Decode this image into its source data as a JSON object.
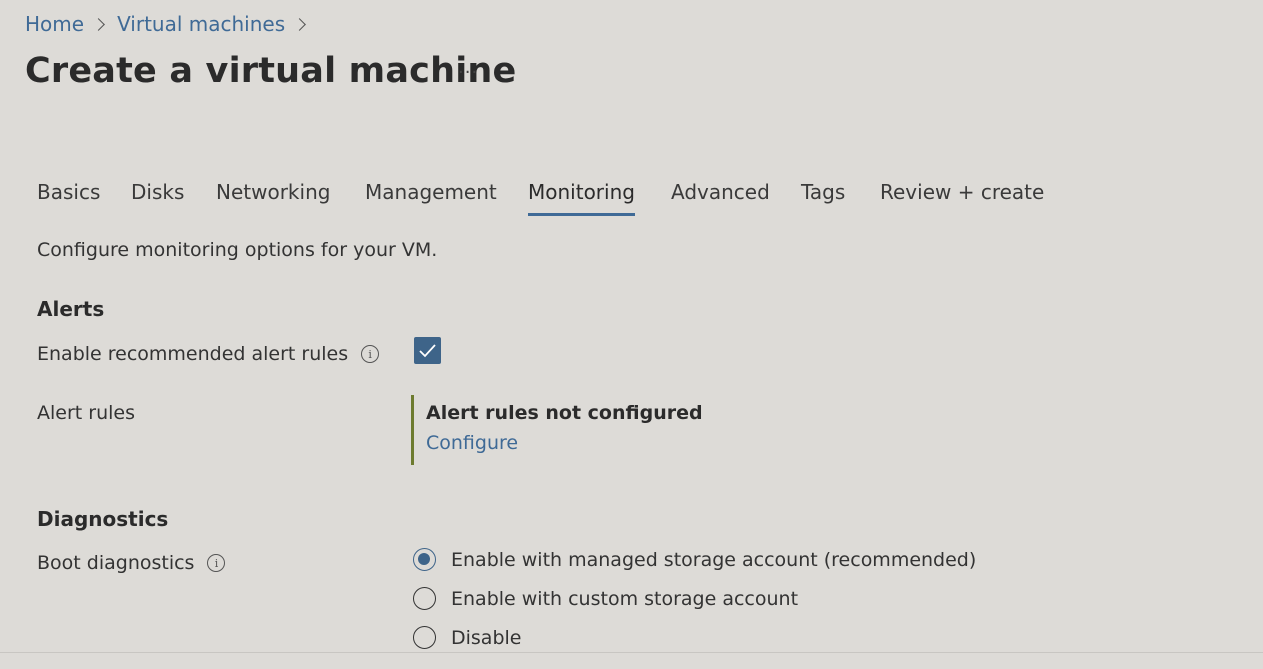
{
  "breadcrumb": {
    "items": [
      "Home",
      "Virtual machines"
    ]
  },
  "page": {
    "title": "Create a virtual machine",
    "more": "···"
  },
  "tabs": [
    {
      "label": "Basics"
    },
    {
      "label": "Disks"
    },
    {
      "label": "Networking"
    },
    {
      "label": "Management"
    },
    {
      "label": "Monitoring",
      "active": true
    },
    {
      "label": "Advanced"
    },
    {
      "label": "Tags"
    },
    {
      "label": "Review + create"
    }
  ],
  "description": "Configure monitoring options for your VM.",
  "alerts": {
    "heading": "Alerts",
    "enable_label": "Enable recommended alert rules",
    "enable_checked": true,
    "rules_label": "Alert rules",
    "status_title": "Alert rules not configured",
    "configure_link": "Configure"
  },
  "diagnostics": {
    "heading": "Diagnostics",
    "boot_label": "Boot diagnostics",
    "options": [
      {
        "label": "Enable with managed storage account (recommended)",
        "selected": true
      },
      {
        "label": "Enable with custom storage account",
        "selected": false
      },
      {
        "label": "Disable",
        "selected": false
      }
    ]
  },
  "colors": {
    "accent": "#3e6489",
    "link": "#3f6a96",
    "alert_bar": "#6d7b2f",
    "background": "#dddbd7"
  },
  "icons": [
    "chevron-right-icon",
    "more-icon",
    "info-icon",
    "checkmark-icon"
  ]
}
